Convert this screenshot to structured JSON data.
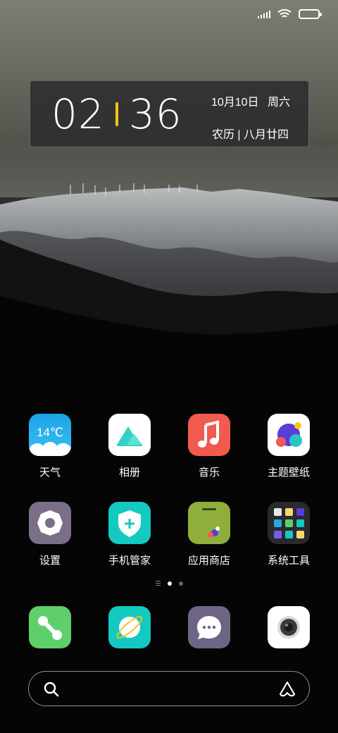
{
  "status_bar": {
    "signal_icon": "signal-bars-icon",
    "wifi_icon": "wifi-icon",
    "battery_icon": "battery-icon",
    "battery_level": 1.0
  },
  "clock": {
    "hour": "02",
    "minute": "36",
    "date": "10月10日 周六",
    "lunar": "农历 | 八月廿四",
    "separator_color": "#f5c518"
  },
  "apps": [
    {
      "label": "天气",
      "icon": "weather-icon",
      "badge": "14℃"
    },
    {
      "label": "相册",
      "icon": "gallery-icon"
    },
    {
      "label": "音乐",
      "icon": "music-icon"
    },
    {
      "label": "主题壁纸",
      "icon": "theme-icon"
    },
    {
      "label": "设置",
      "icon": "settings-icon"
    },
    {
      "label": "手机管家",
      "icon": "phone-manager-icon"
    },
    {
      "label": "应用商店",
      "icon": "app-store-icon"
    },
    {
      "label": "系统工具",
      "icon": "system-tools-folder-icon"
    }
  ],
  "dock": [
    {
      "icon": "phone-icon"
    },
    {
      "icon": "browser-icon"
    },
    {
      "icon": "messages-icon"
    },
    {
      "icon": "camera-icon"
    }
  ],
  "page_indicator": {
    "pages": 2,
    "current": 1
  },
  "search": {
    "search_icon": "search-icon",
    "assistant_icon": "assistant-icon"
  },
  "colors": {
    "weather": "#2aa6e6",
    "music": "#f05a4f",
    "settings": "#7a6f86",
    "phone_manager": "#14c9c0",
    "app_store": "#8fae3c",
    "phone": "#5fcf6b",
    "browser": "#14c9c0",
    "messages": "#6e6484"
  }
}
